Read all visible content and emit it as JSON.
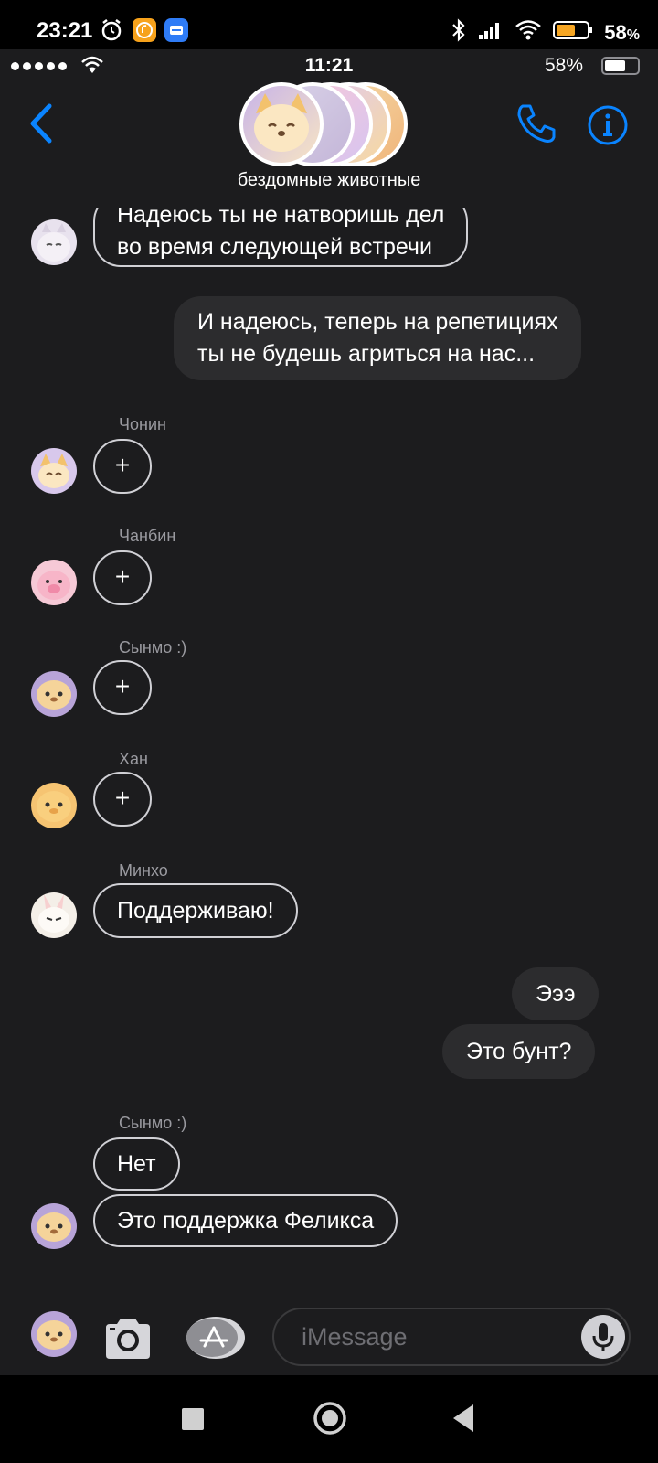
{
  "android_status": {
    "time": "23:21",
    "battery_pct": "58",
    "battery_unit": "%"
  },
  "ios_status": {
    "time": "11:21",
    "battery": "58%"
  },
  "header": {
    "group_name": "бездомные животные"
  },
  "messages": {
    "m1_line1": "Надеюсь ты не натворишь дел",
    "m1_line2": "во время следующей встречи",
    "m2_line1": "И надеюсь, теперь на репетициях",
    "m2_line2": "ты не будешь агриться на нас...",
    "sender_jeongin": "Чонин",
    "sender_changbin": "Чанбин",
    "sender_seungmin": "Сынмо :)",
    "sender_han": "Хан",
    "sender_minho": "Минхо",
    "plus": "+",
    "minho_msg": "Поддерживаю!",
    "out_eee": "Эээ",
    "out_bunt": "Это бунт?",
    "sender_seungmin2": "Сынмо :)",
    "seungmin_net": "Нет",
    "seungmin_support": "Это поддержка Феликса"
  },
  "input": {
    "placeholder": "iMessage"
  },
  "colors": {
    "accent": "#0a84ff",
    "chat_bg": "#1c1c1e",
    "bubble_out": "#2c2c2e"
  }
}
